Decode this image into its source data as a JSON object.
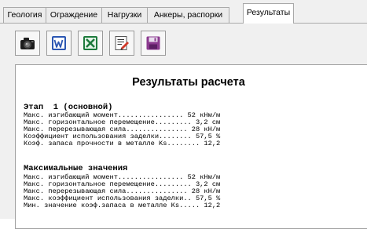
{
  "tabs": [
    {
      "label": "Геология"
    },
    {
      "label": "Ограждение"
    },
    {
      "label": "Нагрузки"
    },
    {
      "label": "Анкеры, распорки"
    },
    {
      "label": "Результаты",
      "active": true
    }
  ],
  "toolbar": [
    {
      "icon": "camera-icon"
    },
    {
      "icon": "word-icon"
    },
    {
      "icon": "excel-icon"
    },
    {
      "icon": "edit-icon"
    },
    {
      "icon": "save-icon"
    }
  ],
  "report": {
    "title": "Результаты расчета",
    "sections": [
      {
        "heading": "Этап  1 (основной)",
        "lines": [
          "Макс. изгибающий момент................ 52 кНм/м",
          "Макс. горизонтальное перемещение......... 3,2 см",
          "Макс. перерезывающая сила............... 28 кН/м",
          "Коэффициент использования заделки........ 57,5 %",
          "Коэф. запаса прочности в металле Ks........ 12,2"
        ]
      },
      {
        "heading": "Максимальные значения",
        "lines": [
          "Макс. изгибающий момент................ 52 кНм/м",
          "Макс. горизонтальное перемещение......... 3,2 см",
          "Макс. перерезывающая сила............... 28 кН/м",
          "Макс. коэффициент использования заделки.. 57,5 %",
          "Мин. значение коэф.запаса в металле Ks..... 12,2"
        ]
      }
    ]
  }
}
